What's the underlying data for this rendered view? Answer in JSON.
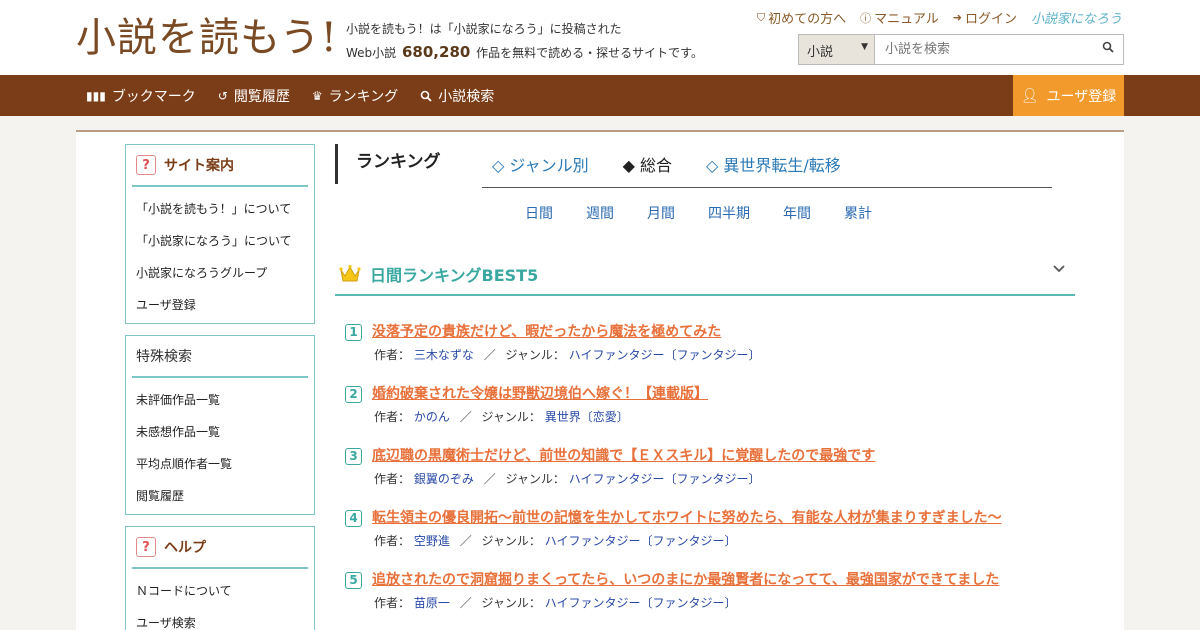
{
  "header": {
    "logo": "小説を読もう!",
    "tagline_line1": "小説を読もう！は「小説家になろう」に投稿された",
    "tagline_prefix": "Web小説",
    "work_count": "680,280",
    "tagline_suffix": "作品を無料で読める・探せるサイトです。",
    "links": [
      {
        "label": "初めての方へ",
        "icon": "shield-icon"
      },
      {
        "label": "マニュアル",
        "icon": "question-circle-icon"
      },
      {
        "label": "ログイン",
        "icon": "login-arrow-icon"
      }
    ],
    "narou_logo": "小説家になろう",
    "search": {
      "category": "小説",
      "placeholder": "小説を検索"
    }
  },
  "nav": {
    "items": [
      {
        "label": "ブックマーク",
        "icon": "bookmark-books-icon"
      },
      {
        "label": "閲覧履歴",
        "icon": "history-icon"
      },
      {
        "label": "ランキング",
        "icon": "crown-icon"
      },
      {
        "label": "小説検索",
        "icon": "search-icon"
      }
    ],
    "register": "ユーザ登録"
  },
  "sidebar": {
    "guide": {
      "title": "サイト案内",
      "items": [
        "「小説を読もう！」について",
        "「小説家になろう」について",
        "小説家になろうグループ",
        "ユーザ登録"
      ]
    },
    "special": {
      "title": "特殊検索",
      "items": [
        "未評価作品一覧",
        "未感想作品一覧",
        "平均点順作者一覧",
        "閲覧履歴"
      ]
    },
    "help": {
      "title": "ヘルプ",
      "items": [
        "Ｎコードについて",
        "ユーザ検索"
      ]
    }
  },
  "ranking": {
    "heading": "ランキング",
    "tabs": [
      {
        "label": "◇ ジャンル別",
        "active": false
      },
      {
        "label": "◆ 総合",
        "active": true
      },
      {
        "label": "◇ 異世界転生/転移",
        "active": false
      }
    ],
    "periods": [
      "日間",
      "週間",
      "月間",
      "四半期",
      "年間",
      "累計"
    ],
    "section_title": "日間ランキングBEST5",
    "author_label": "作者：",
    "genre_label": "ジャンル：",
    "separator": "／",
    "items": [
      {
        "rank": "1",
        "title": "没落予定の貴族だけど、暇だったから魔法を極めてみた",
        "author": "三木なずな",
        "genre": "ハイファンタジー〔ファンタジー〕"
      },
      {
        "rank": "2",
        "title": "婚約破棄された令嬢は野獣辺境伯へ嫁ぐ！【連載版】",
        "author": "かのん",
        "genre": "異世界〔恋愛〕"
      },
      {
        "rank": "3",
        "title": "底辺職の黒魔術士だけど、前世の知識で【ＥＸスキル】に覚醒したので最強です",
        "author": "銀翼のぞみ",
        "genre": "ハイファンタジー〔ファンタジー〕"
      },
      {
        "rank": "4",
        "title": "転生領主の優良開拓〜前世の記憶を生かしてホワイトに努めたら、有能な人材が集まりすぎました〜",
        "author": "空野進",
        "genre": "ハイファンタジー〔ファンタジー〕"
      },
      {
        "rank": "5",
        "title": "追放されたので洞窟掘りまくってたら、いつのまにか最強賢者になってて、最強国家ができてました",
        "author": "苗原一",
        "genre": "ハイファンタジー〔ファンタジー〕"
      }
    ]
  },
  "colors": {
    "brown": "#7a3d17",
    "orange": "#f39a2d",
    "teal": "#3aa8a0",
    "title_orange": "#e8703a"
  }
}
